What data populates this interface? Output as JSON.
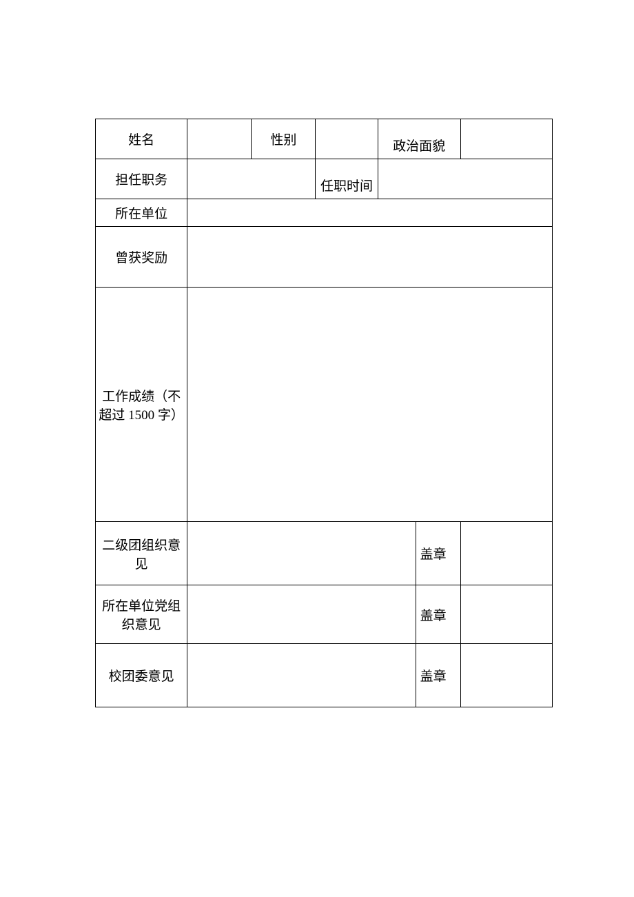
{
  "form": {
    "row1": {
      "name_label": "姓名",
      "name_value": "",
      "gender_label": "性别",
      "gender_value": "",
      "political_label": "政治面貌",
      "political_value": ""
    },
    "row2": {
      "position_label": "担任职务",
      "position_value": "",
      "tenure_label": "任职时间",
      "tenure_value": ""
    },
    "row3": {
      "unit_label": "所在单位",
      "unit_value": ""
    },
    "row4": {
      "awards_label": "曾获奖励",
      "awards_value": ""
    },
    "row5": {
      "work_label": "工作成绩（不超过 1500 字）",
      "work_value": ""
    },
    "row6": {
      "opinion1_label": "二级团组织意见",
      "opinion1_value": "",
      "stamp_label": "盖章",
      "stamp_value": ""
    },
    "row7": {
      "opinion2_label": "所在单位党组织意见",
      "opinion2_value": "",
      "stamp_label": "盖章",
      "stamp_value": ""
    },
    "row8": {
      "opinion3_label": "校团委意见",
      "opinion3_value": "",
      "stamp_label": "盖章",
      "stamp_value": ""
    }
  }
}
